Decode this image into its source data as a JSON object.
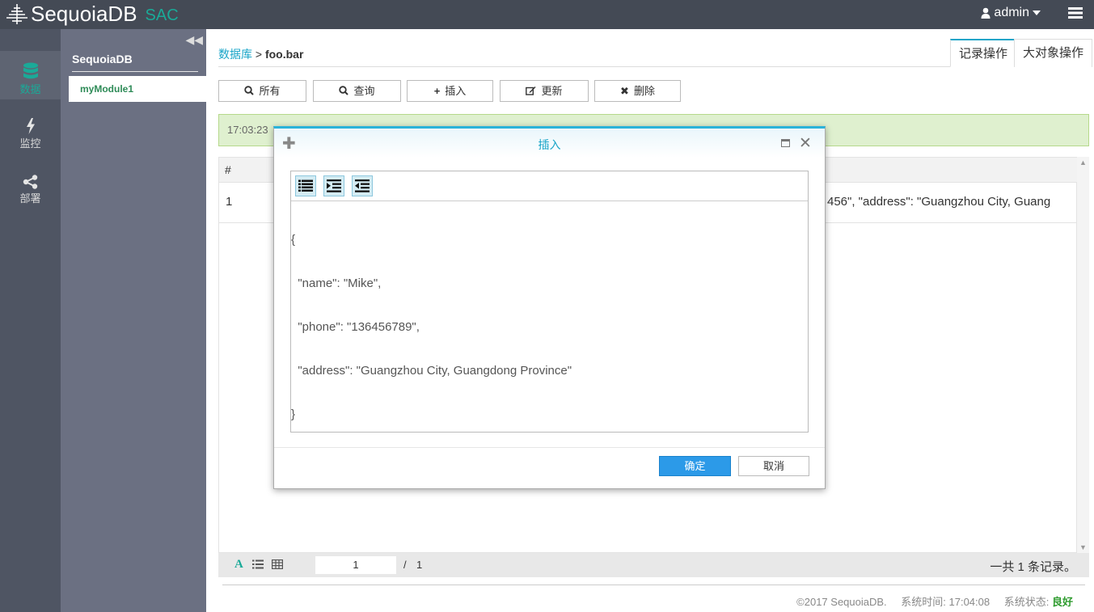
{
  "header": {
    "app_name": "SequoiaDB",
    "app_suffix": "SAC",
    "user": "admin"
  },
  "nav": {
    "items": [
      {
        "label": "数据",
        "icon": "database-icon",
        "active": true
      },
      {
        "label": "监控",
        "icon": "lightning-icon",
        "active": false
      },
      {
        "label": "部署",
        "icon": "share-icon",
        "active": false
      }
    ]
  },
  "modules": {
    "title": "SequoiaDB",
    "items": [
      "myModule1"
    ]
  },
  "breadcrumb": {
    "link": "数据库",
    "separator": ">",
    "current": "foo.bar"
  },
  "tabs": [
    "记录操作",
    "大对象操作"
  ],
  "toolbar": {
    "all": "所有",
    "query": "查询",
    "insert": "插入",
    "update": "更新",
    "delete": "删除"
  },
  "alert": {
    "time": "17:03:23"
  },
  "grid": {
    "header": "#",
    "rows": [
      {
        "num": "1",
        "visible_text": "456\", \"address\": \"Guangzhou City, Guang"
      }
    ]
  },
  "pager": {
    "current_page": "1",
    "separator": "/",
    "total_pages": "1",
    "record_count": "一共 1 条记录。"
  },
  "footer": {
    "copyright": "©2017 SequoiaDB.",
    "time_label": "系统时间: 17:04:08",
    "status_label": "系统状态:",
    "status_value": "良好"
  },
  "modal": {
    "title": "插入",
    "code_lines": [
      "{",
      "  \"name\": \"Mike\",",
      "  \"phone\": \"136456789\",",
      "  \"address\": \"Guangzhou City, Guangdong Province\"",
      "}"
    ],
    "ok": "确定",
    "cancel": "取消"
  },
  "colors": {
    "accent": "#1aa5c8",
    "brand_green": "#1aaa98",
    "topbar": "#444a55",
    "nav_bg": "#4f5563",
    "module_bg": "#6b7082",
    "primary_button": "#2c9ae8"
  }
}
